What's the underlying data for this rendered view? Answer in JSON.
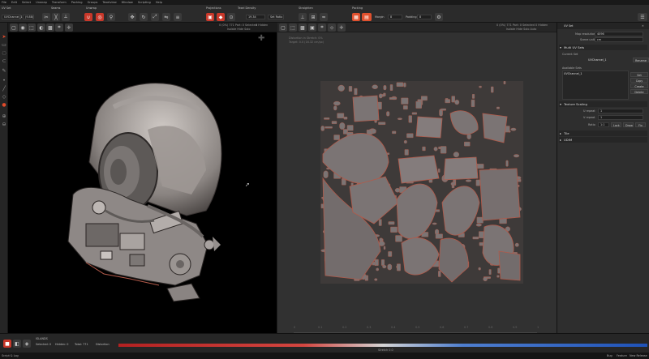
{
  "menu": [
    "File",
    "Edit",
    "Select",
    "Unwrap",
    "Transform",
    "Packing",
    "Groups",
    "Texelview",
    "Window",
    "Scripting",
    "Help"
  ],
  "shelf": {
    "uv_set_label": "UV Set",
    "uv_set_value": "UVChannel_1",
    "zoom_value": "(9.88)",
    "seams_label": "Seams",
    "unwrap_label": "Unwrap",
    "projections_label": "Projections",
    "texel_density_label": "Texel Density",
    "texel_value": "19.34",
    "texel_mode": "Set Ratio",
    "straighten_label": "Straighten",
    "packing_label": "Packing",
    "margin_label": "Margin",
    "margin_value": "8",
    "padding_label": "Padding",
    "padding_value": "8"
  },
  "vp3d": {
    "info_counts": "0 (0%) 771 Part: 0 Selected",
    "info_visible": "0 Hidden",
    "info_modes": "Isolate   Hide   Solo"
  },
  "vpuv": {
    "info_counts": "0 (0%) 771 Part: 0 Selected",
    "info_visible": "0 Hidden",
    "info_modes": "Isolate   Hide   Solo   Auto",
    "overlay_line1": "Distortion in Stretch: 0%",
    "overlay_line2": "Target: 0.0 (16.32 cm/px)",
    "bottom_ruler": [
      "0",
      "0.1",
      "0.2",
      "0.3",
      "0.4",
      "0.5",
      "0.6",
      "0.7",
      "0.8",
      "0.9",
      "1"
    ]
  },
  "panel": {
    "title": "UV Set",
    "map_resolution_label": "Map resolution",
    "map_resolution_value": "4096",
    "scene_unit_label": "Scene unit",
    "scene_unit_value": "cm",
    "multi_uv_sets": "Multi UV Sets",
    "current_set_label": "Current Set",
    "current_set_value": "UVChannel_1",
    "rename_btn": "Rename",
    "available_sets_label": "Available Sets",
    "available_item": "UVChannel_1",
    "set_current_btn": "Set Current",
    "copy_btn": "Copy",
    "create_btn": "Create",
    "delete_btn": "Delete",
    "texture_scaling": "Texture Scaling",
    "u_repeat_label": "U repeat",
    "u_repeat_value": "1",
    "v_repeat_label": "V repeat",
    "v_repeat_value": "1",
    "ratio_label": "Ratio",
    "ratio_value": "1:1",
    "lock_btn": "Lock",
    "draw_btn": "Draw",
    "fix_btn": "Fix",
    "tile_label": "Tile",
    "udim_label": "UDIM"
  },
  "status": {
    "islands_label": "ISLANDS",
    "selected": "Selected: 0",
    "hidden": "Hidden: 0",
    "total": "Total: 771",
    "distortion_label": "Distortion",
    "gradient_center": "Stretch 0.0"
  },
  "footer": {
    "left": "Script & Log",
    "right_items": [
      "Bug",
      "Feature",
      "New Release"
    ]
  },
  "colors": {
    "accent": "#e0512e",
    "panel": "#2e2e2e",
    "uv_background": "#313131",
    "uv_island": "#7b7474",
    "uv_edge": "#b25a4a"
  }
}
